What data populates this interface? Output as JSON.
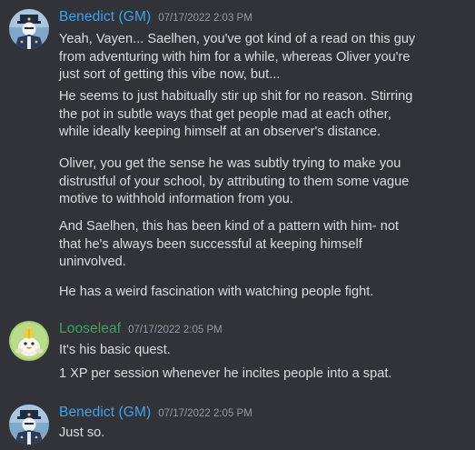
{
  "messages": [
    {
      "username": "Benedict (GM)",
      "timestamp": "07/17/2022 2:03 PM",
      "avatar_icon": "blue-uniformed-figure-avatar",
      "paragraphs": [
        [
          "Yeah, Vayen... Saelhen, you've got kind of a read on this guy",
          "from adventuring with him for a while, whereas Oliver you're",
          "just sort of getting this vibe now, but..."
        ],
        [
          "He seems to just habitually stir up shit for no reason. Stirring",
          "the pot in subtle ways that get people mad at each other,",
          "while ideally keeping himself at an observer's distance."
        ],
        [
          "Oliver, you get the sense he was subtly trying to make you",
          "distrustful of your school, by attributing to them some vague",
          "motive to withhold information from you."
        ],
        [
          "And Saelhen, this has been kind of a pattern with him- not",
          "that he's always been successful at keeping himself",
          "uninvolved."
        ],
        [
          "He has a weird fascination with watching people fight."
        ]
      ]
    },
    {
      "username": "Looseleaf",
      "timestamp": "07/17/2022 2:05 PM",
      "avatar_icon": "leaf-creature-avatar",
      "paragraphs": [
        [
          "It's his basic quest."
        ],
        [
          "1 XP per session whenever he incites people into a spat."
        ]
      ]
    },
    {
      "username": "Benedict (GM)",
      "timestamp": "07/17/2022 2:05 PM",
      "avatar_icon": "blue-uniformed-figure-avatar",
      "paragraphs": [
        [
          "Just so."
        ]
      ]
    }
  ],
  "colors": {
    "background": "#313338",
    "gm_name": "#3fa4e8",
    "leaf_name": "#3ba55d",
    "text": "#dbdee1",
    "timestamp": "#949ba4"
  }
}
